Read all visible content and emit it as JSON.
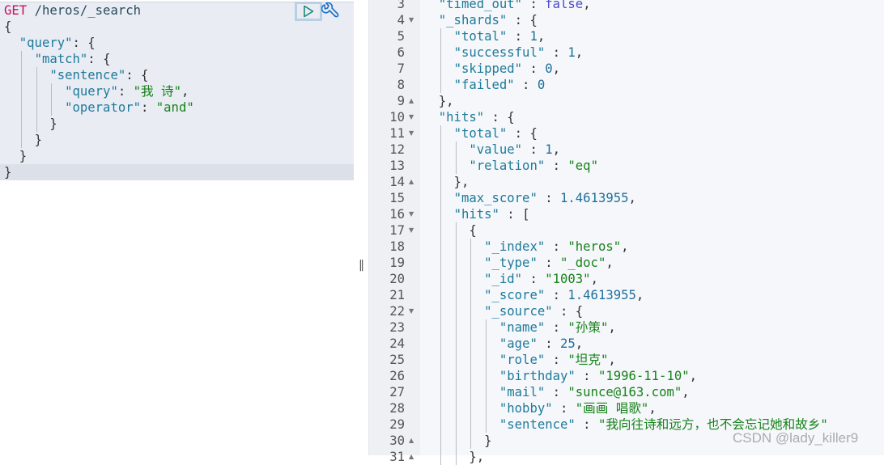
{
  "request": {
    "lines": [
      "GET /heros/_search",
      "{",
      "  \"query\": {",
      "    \"match\": {",
      "      \"sentence\": {",
      "        \"query\": \"我 诗\",",
      "        \"operator\": \"and\"",
      "      }",
      "    }",
      "  }",
      "}"
    ],
    "run_icon": "play-icon",
    "settings_icon": "wrench-icon"
  },
  "divider_icon": "drag-handle-icon",
  "response": {
    "first_line_number": 3,
    "lines": [
      "  \"timed_out\" : false,",
      "  \"_shards\" : {",
      "    \"total\" : 1,",
      "    \"successful\" : 1,",
      "    \"skipped\" : 0,",
      "    \"failed\" : 0",
      "  },",
      "  \"hits\" : {",
      "    \"total\" : {",
      "      \"value\" : 1,",
      "      \"relation\" : \"eq\"",
      "    },",
      "    \"max_score\" : 1.4613955,",
      "    \"hits\" : [",
      "      {",
      "        \"_index\" : \"heros\",",
      "        \"_type\" : \"_doc\",",
      "        \"_id\" : \"1003\",",
      "        \"_score\" : 1.4613955,",
      "        \"_source\" : {",
      "          \"name\" : \"孙策\",",
      "          \"age\" : 25,",
      "          \"role\" : \"坦克\",",
      "          \"birthday\" : \"1996-11-10\",",
      "          \"mail\" : \"sunce@163.com\",",
      "          \"hobby\" : \"画画 唱歌\",",
      "          \"sentence\" : \"我向往诗和远方，也不会忘记她和故乡\"",
      "        }",
      "      },"
    ],
    "folds": {
      "4": "open",
      "9": "close",
      "10": "open",
      "11": "open",
      "14": "close",
      "16": "open",
      "17": "open",
      "22": "open",
      "30": "close",
      "31": "close"
    }
  },
  "watermark": "CSDN @lady_killer9",
  "colors": {
    "method": "#c5105f",
    "key": "#1d7a9b",
    "string": "#17821a",
    "number": "#1d6f9b",
    "boolean": "#4a4ad0",
    "run_button": "#b8d0e6"
  }
}
